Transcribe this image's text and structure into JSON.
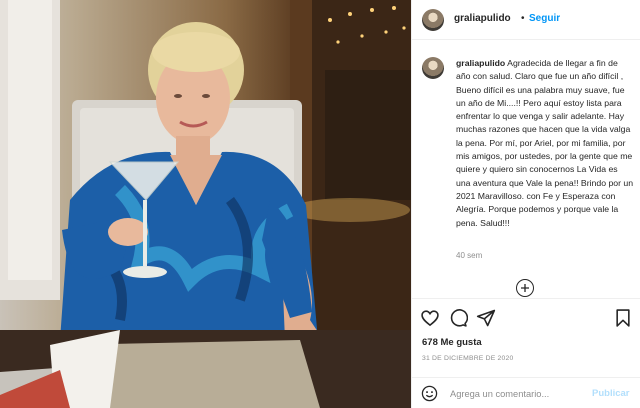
{
  "post": {
    "username": "graliapulido",
    "separator": "•",
    "follow_label": "Seguir",
    "caption_text": "Agradecida de llegar a fin de año con salud. Claro que fue un año difícil , Bueno difícil es una palabra muy suave, fue un año de Mi....!! Pero aquí estoy lista para enfrentar lo que venga y salir adelante. Hay muchas razones que hacen que la vida valga la pena. Por mí, por Ariel, por mi familia, por mis amigos, por ustedes, por la gente que me quiere y quiero sin conocernos La Vida es una aventura que Vale la pena!! Brindo por un 2021 Maravilloso. con Fe y Esperaza con Alegría. Porque podemos y porque vale la pena. Salud!!!",
    "age": "40 sem",
    "likes": "678 Me gusta",
    "date": "31 DE DICIEMBRE DE 2020"
  },
  "comment_box": {
    "placeholder": "Agrega un comentario...",
    "publish_label": "Publicar"
  },
  "icons": {
    "heart": "heart-icon",
    "comment": "comment-icon",
    "share": "share-icon",
    "save": "bookmark-icon",
    "emoji": "emoji-icon",
    "more": "plus-circle-icon"
  },
  "colors": {
    "link_blue": "#0095f6",
    "publish_disabled": "#b2dffc",
    "muted": "#8e8e8e",
    "text": "#262626"
  }
}
